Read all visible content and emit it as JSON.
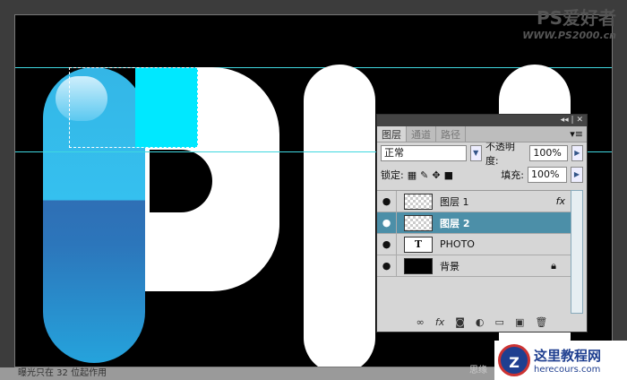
{
  "canvas": {
    "text_letters": "PHOTO"
  },
  "logo": {
    "title": "PS爱好者",
    "url": "WWW.PS2000.cn"
  },
  "status": {
    "text": "曝光只在 32 位起作用"
  },
  "panel": {
    "tabs": [
      "图层",
      "通道",
      "路径"
    ],
    "blend_mode": "正常",
    "opacity_label": "不透明度:",
    "opacity": "100%",
    "lock_label": "锁定:",
    "fill_label": "填充:",
    "fill": "100%",
    "layers": [
      {
        "name": "图层 1",
        "fx": "fx"
      },
      {
        "name": "图层 2"
      },
      {
        "name": "PHOTO",
        "thumb": "T"
      },
      {
        "name": "背景"
      }
    ]
  },
  "watermark": {
    "title": "这里教程网",
    "url": "herecours.com",
    "side_text": "思缘"
  }
}
